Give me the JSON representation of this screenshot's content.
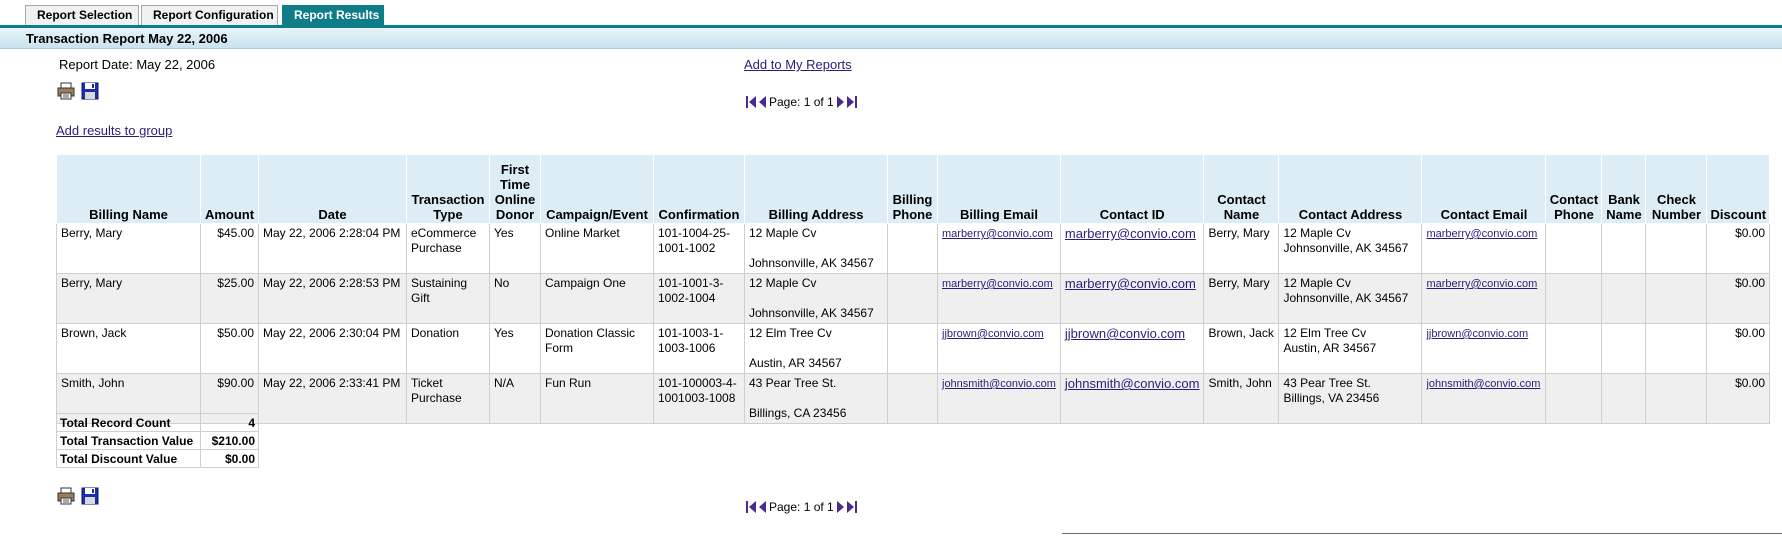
{
  "tabs": [
    {
      "label": "Report Selection",
      "active": false
    },
    {
      "label": "Report Configuration",
      "active": false
    },
    {
      "label": "Report Results",
      "active": true
    }
  ],
  "title": "Transaction Report May 22, 2006",
  "report_date": "Report Date: May 22, 2006",
  "add_to_reports": "Add to My Reports",
  "add_results_to_group": "Add results to group",
  "pager": {
    "label": "Page: 1 of 1"
  },
  "icons": {
    "print": "printer-icon",
    "save": "save-disk-icon",
    "first": "first-page-icon",
    "prev": "prev-page-icon",
    "next": "next-page-icon",
    "last": "last-page-icon"
  },
  "colors": {
    "accent": "#0f7d88",
    "header_bg": "#dcedf5",
    "link": "#2c1d7a",
    "alt_row": "#efefef"
  },
  "columns": [
    "Billing Name",
    "Amount",
    "Date",
    "Transaction Type",
    "First Time Online Donor",
    "Campaign/Event",
    "Confirmation",
    "Billing Address",
    "Billing Phone",
    "Billing Email",
    "Contact ID",
    "Contact Name",
    "Contact Address",
    "Contact Email",
    "Contact Phone",
    "Bank Name",
    "Check Number",
    "Discount"
  ],
  "rows": [
    {
      "billing_name": "Berry, Mary",
      "amount": "$45.00",
      "date": "May 22, 2006 2:28:04 PM",
      "transaction_type": "eCommerce Purchase",
      "first_time": "Yes",
      "campaign": "Online Market",
      "confirmation": "101-1004-25-1001-1002",
      "billing_addr1": "12 Maple Cv",
      "billing_addr2": "Johnsonville,  AK  34567",
      "billing_phone": "",
      "billing_email": "marberry@convio.com",
      "contact_id": "marberry@convio.com",
      "contact_name": "Berry, Mary",
      "contact_addr1": "12 Maple Cv",
      "contact_addr2": "Johnsonville,  AK  34567",
      "contact_email": "marberry@convio.com",
      "contact_phone": "",
      "bank_name": "",
      "check_number": "",
      "discount": "$0.00"
    },
    {
      "billing_name": "Berry, Mary",
      "amount": "$25.00",
      "date": "May 22, 2006 2:28:53 PM",
      "transaction_type": "Sustaining Gift",
      "first_time": "No",
      "campaign": "Campaign One",
      "confirmation": "101-1001-3-1002-1004",
      "billing_addr1": "12 Maple Cv",
      "billing_addr2": "Johnsonville,  AK  34567",
      "billing_phone": "",
      "billing_email": "marberry@convio.com",
      "contact_id": "marberry@convio.com",
      "contact_name": "Berry, Mary",
      "contact_addr1": "12 Maple Cv",
      "contact_addr2": "Johnsonville,  AK  34567",
      "contact_email": "marberry@convio.com",
      "contact_phone": "",
      "bank_name": "",
      "check_number": "",
      "discount": "$0.00"
    },
    {
      "billing_name": "Brown, Jack",
      "amount": "$50.00",
      "date": "May 22, 2006 2:30:04 PM",
      "transaction_type": "Donation",
      "first_time": "Yes",
      "campaign": "Donation Classic Form",
      "confirmation": "101-1003-1-1003-1006",
      "billing_addr1": "12 Elm Tree Cv",
      "billing_addr2": "Austin,  AR  34567",
      "billing_phone": "",
      "billing_email": "jjbrown@convio.com",
      "contact_id": "jjbrown@convio.com",
      "contact_name": "Brown, Jack",
      "contact_addr1": "12 Elm Tree Cv",
      "contact_addr2": "Austin,  AR  34567",
      "contact_email": "jjbrown@convio.com",
      "contact_phone": "",
      "bank_name": "",
      "check_number": "",
      "discount": "$0.00"
    },
    {
      "billing_name": "Smith, John",
      "amount": "$90.00",
      "date": "May 22, 2006 2:33:41 PM",
      "transaction_type": "Ticket Purchase",
      "first_time": "N/A",
      "campaign": "Fun Run",
      "confirmation": "101-100003-4-1001003-1008",
      "billing_addr1": "43 Pear Tree St.",
      "billing_addr2": "Billings,  CA  23456",
      "billing_phone": "",
      "billing_email": "johnsmith@convio.com",
      "contact_id": "johnsmith@convio.com",
      "contact_name": "Smith, John",
      "contact_addr1": "43 Pear Tree St.",
      "contact_addr2": "Billings,  VA  23456",
      "contact_email": "johnsmith@convio.com",
      "contact_phone": "",
      "bank_name": "",
      "check_number": "",
      "discount": "$0.00"
    }
  ],
  "totals": [
    {
      "label": "Total Record Count",
      "value": "4"
    },
    {
      "label": "Total Transaction Value",
      "value": "$210.00"
    },
    {
      "label": "Total Discount Value",
      "value": "$0.00"
    }
  ]
}
